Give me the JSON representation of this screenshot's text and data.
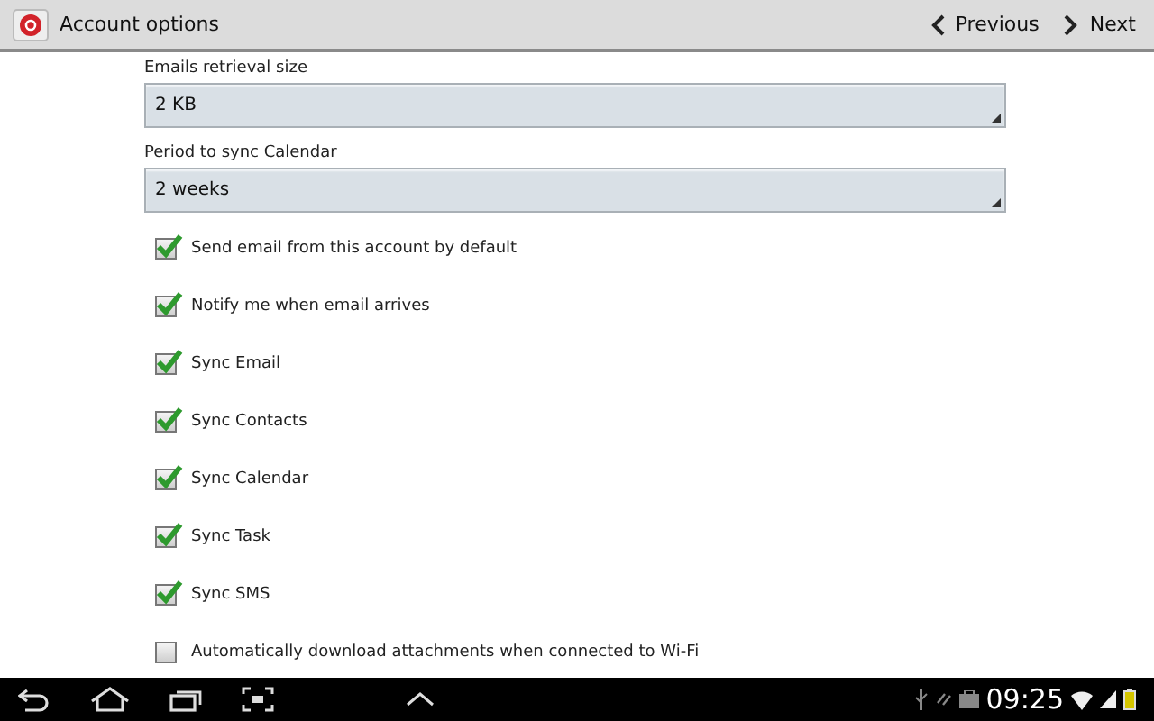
{
  "header": {
    "title": "Account options",
    "previous": "Previous",
    "next": "Next"
  },
  "dropdowns": [
    {
      "label": "Emails retrieval size",
      "value": "2 KB"
    },
    {
      "label": "Period to sync Calendar",
      "value": "2 weeks"
    }
  ],
  "options": [
    {
      "label": "Send email from this account by default",
      "checked": true
    },
    {
      "label": "Notify me when email arrives",
      "checked": true
    },
    {
      "label": "Sync Email",
      "checked": true
    },
    {
      "label": "Sync Contacts",
      "checked": true
    },
    {
      "label": "Sync Calendar",
      "checked": true
    },
    {
      "label": "Sync Task",
      "checked": true
    },
    {
      "label": "Sync SMS",
      "checked": true
    },
    {
      "label": "Automatically download attachments when connected to Wi-Fi",
      "checked": false
    }
  ],
  "status_bar": {
    "time": "09:25"
  }
}
